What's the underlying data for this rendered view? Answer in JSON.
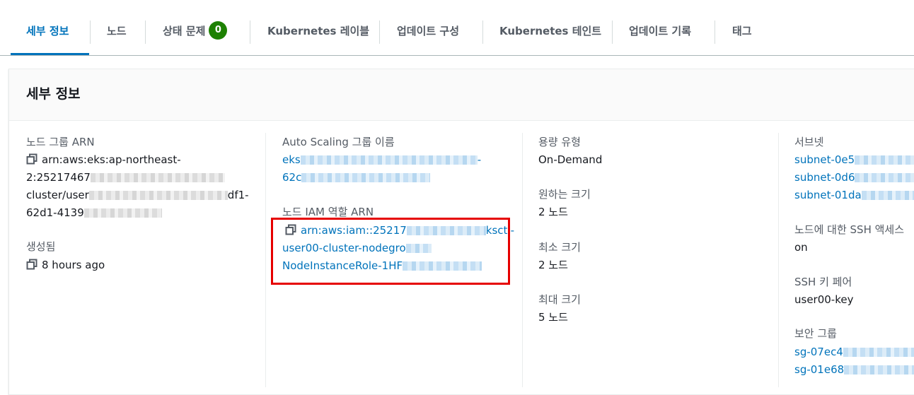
{
  "tabs": [
    {
      "label": "세부 정보",
      "active": true
    },
    {
      "label": "노드"
    },
    {
      "label": "상태 문제",
      "badge": "0"
    },
    {
      "label": "Kubernetes 레이블"
    },
    {
      "label": "업데이트 구성"
    },
    {
      "label": "Kubernetes 테인트"
    },
    {
      "label": "업데이트 기록"
    },
    {
      "label": "태그"
    }
  ],
  "panel": {
    "title": "세부 정보"
  },
  "col1": {
    "arn_label": "노드 그룹 ARN",
    "arn_line1": "arn:aws:eks:ap-northeast-",
    "arn_line2": "2:25217467",
    "arn_line3a": "cluster/user",
    "arn_line3b": "df1-",
    "arn_line4": "62d1-4139",
    "created_label": "생성됨",
    "created_value": "8 hours ago"
  },
  "col2": {
    "asg_label": "Auto Scaling 그룹 이름",
    "asg_line1a": "eks",
    "asg_line1b": "-",
    "asg_line2": "62c",
    "role_label": "노드 IAM 역할 ARN",
    "role_line1a": "arn:aws:iam::25217",
    "role_line1b": "ksctl-",
    "role_line2": "user00-cluster-nodegro",
    "role_line3": "NodeInstanceRole-1HF"
  },
  "col3": {
    "capacity_label": "용량 유형",
    "capacity_value": "On-Demand",
    "desired_label": "원하는 크기",
    "desired_value": "2 노드",
    "min_label": "최소 크기",
    "min_value": "2 노드",
    "max_label": "최대 크기",
    "max_value": "5 노드"
  },
  "col4": {
    "subnet_label": "서브넷",
    "subnets": [
      "subnet-0e5",
      "subnet-0d6",
      "subnet-01da"
    ],
    "ssh_label": "노드에 대한 SSH 액세스",
    "ssh_value": "on",
    "keypair_label": "SSH 키 페어",
    "keypair_value": "user00-key",
    "sg_label": "보안 그룹",
    "sgs": [
      "sg-07ec4",
      "sg-01e68"
    ]
  },
  "colors": {
    "accent": "#0073bb",
    "badge": "#1d8102",
    "highlight": "#e60000"
  },
  "icons": {
    "copy": "copy-icon"
  }
}
